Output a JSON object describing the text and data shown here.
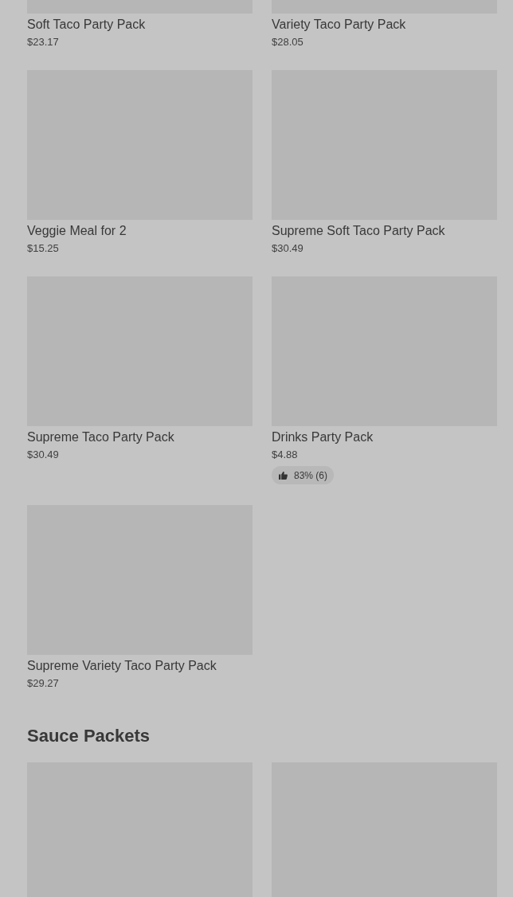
{
  "sections": [
    {
      "items": [
        {
          "kind": "product",
          "name": "Soft Taco Party Pack",
          "price": "$23.17"
        },
        {
          "kind": "product",
          "name": "Variety Taco Party Pack",
          "price": "$28.05"
        },
        {
          "kind": "product",
          "name": "Veggie Meal for 2",
          "price": "$15.25"
        },
        {
          "kind": "product",
          "name": "Supreme Soft Taco Party Pack",
          "price": "$30.49"
        },
        {
          "kind": "product",
          "name": "Supreme Taco Party Pack",
          "price": "$30.49"
        },
        {
          "kind": "product",
          "name": "Drinks Party Pack",
          "price": "$4.88",
          "rating": "83% (6)"
        },
        {
          "kind": "product",
          "name": "Supreme Variety Taco Party Pack",
          "price": "$29.27"
        }
      ]
    },
    {
      "heading": "Sauce Packets",
      "items": [
        {
          "kind": "placeholder"
        },
        {
          "kind": "placeholder"
        }
      ]
    }
  ]
}
